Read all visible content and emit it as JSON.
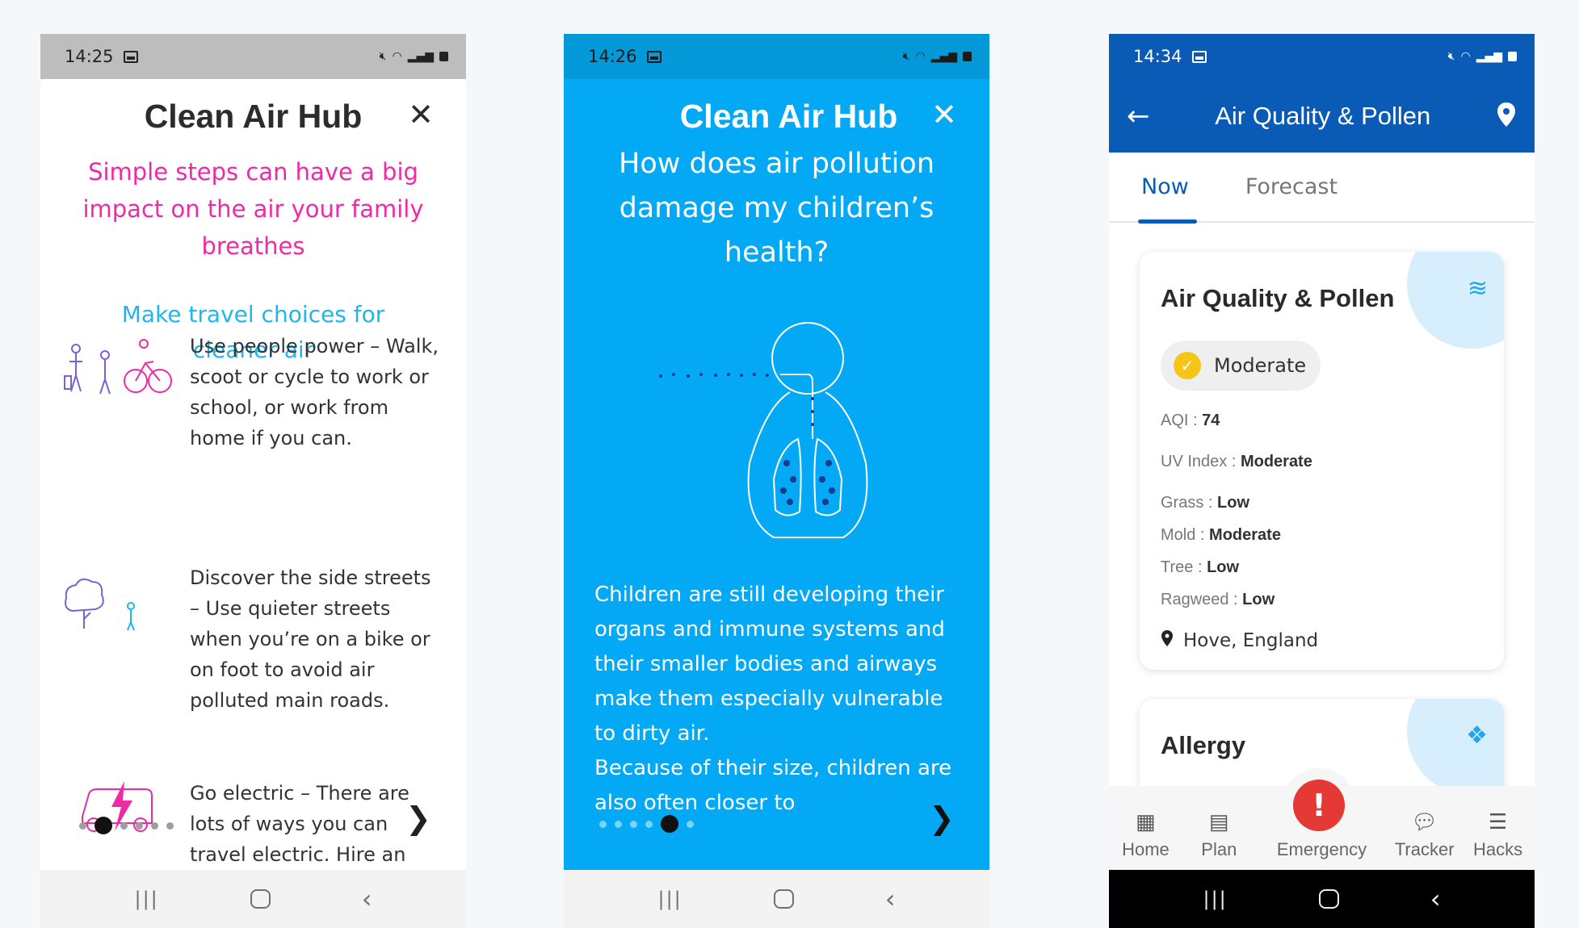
{
  "phone1": {
    "status": {
      "time": "14:25"
    },
    "title": "Clean Air Hub",
    "close": "✕",
    "headline": "Simple steps can have a big impact on the air your family breathes",
    "subheading": "Make travel choices for cleaner air",
    "steps": [
      {
        "text": "Use people power – Walk, scoot or cycle to work or school, or work from home if you can."
      },
      {
        "text": "Discover the side streets – Use quieter streets when you’re on a bike or on foot to avoid air polluted main roads."
      },
      {
        "text": "Go electric – There are lots of ways you can travel electric. Hire an"
      }
    ],
    "next": "❯",
    "colors": {
      "headline": "#ef2aa5",
      "subheading": "#20b5ec"
    }
  },
  "phone2": {
    "status": {
      "time": "14:26"
    },
    "title": "Clean Air Hub",
    "close": "✕",
    "question": "How does air pollution damage my children’s health?",
    "body": "Children are still developing their organs and immune systems and their smaller bodies and airways make them especially vulnerable to dirty air.",
    "body2": "Because of their size, children are also often closer to",
    "next": "❯",
    "colors": {
      "background": "#03a9f4"
    }
  },
  "phone3": {
    "status": {
      "time": "14:34"
    },
    "back": "←",
    "title": "Air Quality & Pollen",
    "tabs": [
      {
        "label": "Now",
        "active": true
      },
      {
        "label": "Forecast",
        "active": false
      }
    ],
    "aq_card": {
      "title": "Air Quality & Pollen",
      "status": "Moderate",
      "aqi_label": "AQI : ",
      "aqi_value": "74",
      "uv_label": "UV Index : ",
      "uv_value": "Moderate",
      "grass_label": "Grass : ",
      "grass_value": "Low",
      "mold_label": "Mold : ",
      "mold_value": "Moderate",
      "tree_label": "Tree : ",
      "tree_value": "Low",
      "ragweed_label": "Ragweed : ",
      "ragweed_value": "Low",
      "location": "Hove, England"
    },
    "allergy_card": {
      "title": "Allergy"
    },
    "bottom_nav": [
      {
        "label": "Home",
        "icon": "home-grid-icon"
      },
      {
        "label": "Plan",
        "icon": "clipboard-icon"
      },
      {
        "label": "Emergency",
        "icon": "alert-icon"
      },
      {
        "label": "Tracker",
        "icon": "chat-icon"
      },
      {
        "label": "Hacks",
        "icon": "stack-icon"
      }
    ],
    "emergency_symbol": "!",
    "colors": {
      "header": "#0a5bb6",
      "emergency": "#e53935",
      "chip_check": "#f5c518"
    }
  }
}
